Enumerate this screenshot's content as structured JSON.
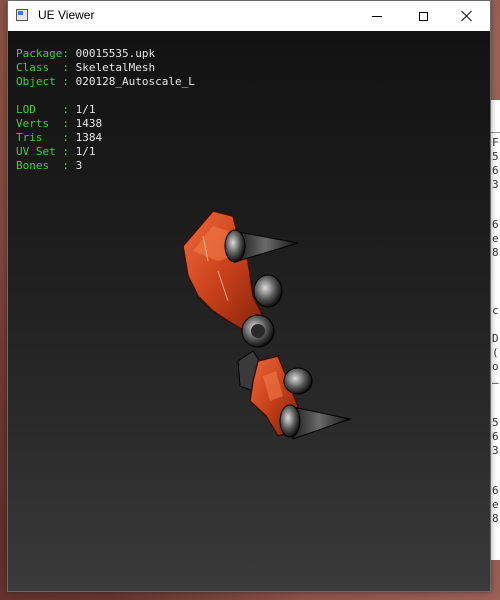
{
  "window": {
    "title": "UE Viewer"
  },
  "info": {
    "rows": [
      {
        "label": "Package: ",
        "value": "00015535.upk"
      },
      {
        "label": "Class  : ",
        "value": "SkeletalMesh"
      },
      {
        "label": "Object : ",
        "value": "020128_Autoscale_L"
      },
      {
        "label": "LOD    : ",
        "value": "1/1"
      },
      {
        "label": "Verts  : ",
        "value": "1438"
      },
      {
        "label": "Tris   : ",
        "value": "1384"
      },
      {
        "label": "UV Set : ",
        "value": "1/1"
      },
      {
        "label": "Bones  : ",
        "value": "3"
      }
    ]
  },
  "background_window": {
    "chars": [
      "F",
      "5",
      "6",
      "3",
      "6",
      "e",
      "8",
      "c",
      "D",
      "(",
      "o",
      "–",
      "5",
      "6",
      "3",
      "6",
      "e",
      "8"
    ]
  },
  "colors": {
    "label": "#3ecf3e",
    "value": "#e6e6e6",
    "model_orange": "#d0461c",
    "model_metal": "#2b2b2b"
  },
  "icons": {
    "app": "app-window-icon",
    "minimize": "minimize-icon",
    "maximize": "maximize-icon",
    "close": "close-icon"
  }
}
